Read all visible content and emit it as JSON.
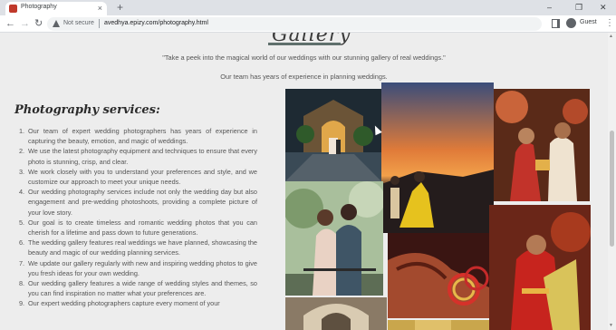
{
  "browser": {
    "tab_title": "Photography",
    "tab_close": "×",
    "new_tab": "+",
    "window_minimize": "–",
    "window_restore": "❐",
    "window_close": "✕",
    "back": "←",
    "forward": "→",
    "reload": "↻",
    "security_label": "Not secure",
    "url": "avedhya.epizy.com/photography.html",
    "profile_label": "Guest",
    "menu": "⋮"
  },
  "page": {
    "heading": "Gallery",
    "intro_quote": "\"Take a peek into the magical world of our weddings with our stunning gallery of real weddings.\"",
    "intro_sub": "Our team has years of experience in planning weddings.",
    "services_title": "Photography services:",
    "services": [
      {
        "num": "1.",
        "text": "Our team of expert wedding photographers has years of experience in capturing the beauty, emotion, and magic of weddings."
      },
      {
        "num": "2.",
        "text": "We use the latest photography equipment and techniques to ensure that every photo is stunning, crisp, and clear."
      },
      {
        "num": "3.",
        "text": "We work closely with you to understand your preferences and style, and we customize our approach to meet your unique needs."
      },
      {
        "num": "4.",
        "text": "Our wedding photography services include not only the wedding day but also engagement and pre-wedding photoshoots, providing a complete picture of your love story."
      },
      {
        "num": "5.",
        "text": "Our goal is to create timeless and romantic wedding photos that you can cherish for a lifetime and pass down to future generations."
      },
      {
        "num": "6.",
        "text": "The wedding gallery features real weddings we have planned, showcasing the beauty and magic of our wedding planning services."
      },
      {
        "num": "7.",
        "text": "We update our gallery regularly with new and inspiring wedding photos to give you fresh ideas for your own wedding."
      },
      {
        "num": "8.",
        "text": "Our wedding gallery features a wide range of wedding styles and themes, so you can find inspiration no matter what your preferences are."
      },
      {
        "num": "9.",
        "text": "Our expert wedding photographers capture every moment of your"
      }
    ]
  },
  "gallery": [
    {
      "name": "photo-castle-couple",
      "subject": "couple at lit castle archway at night"
    },
    {
      "name": "photo-sunset-couple",
      "subject": "couple in yellow dress at sunset"
    },
    {
      "name": "photo-ceremony",
      "subject": "bride and groom in red ceremony"
    },
    {
      "name": "photo-embrace",
      "subject": "couple embracing outdoors"
    },
    {
      "name": "photo-mehndi-hands",
      "subject": "henna hands with bangles"
    },
    {
      "name": "photo-bride-red",
      "subject": "bride in red saree"
    },
    {
      "name": "photo-archway",
      "subject": "stone archway"
    },
    {
      "name": "photo-bottom-right",
      "subject": "partial wedding photo"
    }
  ]
}
